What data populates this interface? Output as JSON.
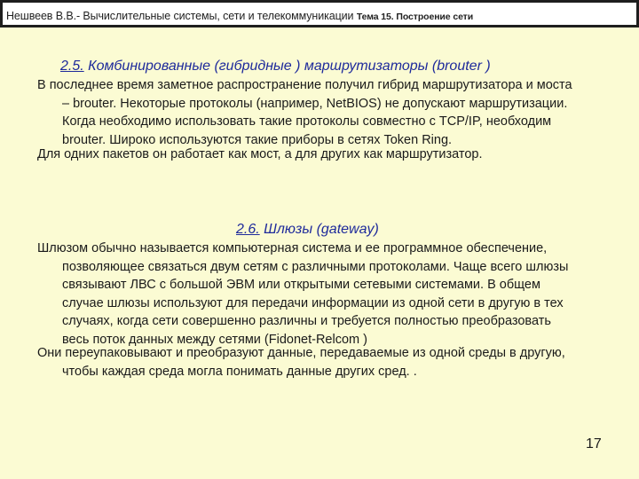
{
  "header": {
    "course": "Нешвеев В.В.- Вычислительные системы, сети и телекоммуникации",
    "topic": "Тема 15. Построение сети"
  },
  "section1": {
    "number": "2.5.",
    "title": " Комбинированные (гибридные ) маршрутизаторы (brouter )",
    "para1": [
      "В последнее время заметное распространение получил гибрид маршрутизатора и моста",
      "– brouter. Некоторые протоколы (например, NetBIOS) не допускают маршрутизации.",
      "Когда необходимо использовать такие протоколы совместно с TCP/IP, необходим",
      "brouter. Широко используются такие приборы в сетях Token Ring."
    ],
    "para2": [
      "Для одних пакетов он работает как мост, а для других как маршрутизатор."
    ]
  },
  "section2": {
    "number": "2.6.",
    "title": " Шлюзы (gateway)",
    "para1": [
      "Шлюзом обычно называется компьютерная система и ее программное обеспечение,",
      "позволяющее связаться двум сетям с различными протоколами. Чаще всего шлюзы",
      "связывают ЛВС с большой ЭВМ или открытыми сетевыми системами. В общем",
      "случае шлюзы используют для передачи информации из одной сети в другую в тех",
      "случаях, когда сети совершенно различны и требуется полностью преобразовать",
      "весь поток данных между сетями (Fidonet-Relcom )"
    ],
    "para2": [
      "Они переупаковывают и преобразуют данные, передаваемые из одной среды в другую,",
      "чтобы каждая среда могла понимать данные других сред. ."
    ]
  },
  "page_number": "17"
}
